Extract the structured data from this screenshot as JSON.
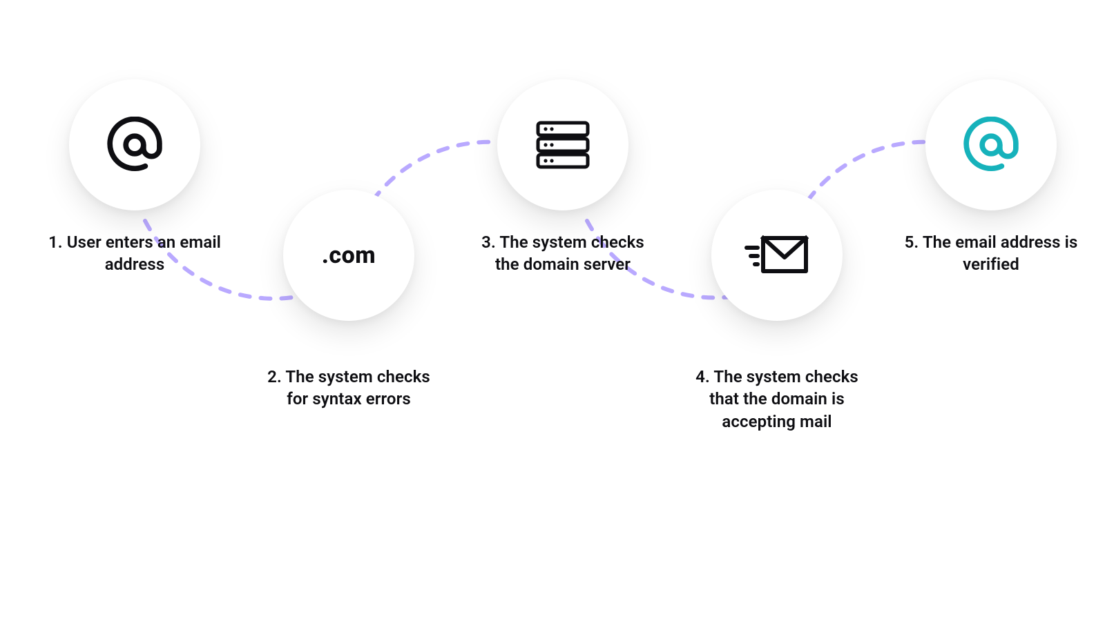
{
  "colors": {
    "text": "#0e0e12",
    "dash": "#b9a9ff",
    "teal": "#16b2bb",
    "black": "#0e0e12"
  },
  "steps": [
    {
      "id": "step1",
      "icon": "at-black",
      "caption": "1. User enters an email address"
    },
    {
      "id": "step2",
      "icon": "dot-com",
      "caption": "2. The system checks for syntax errors",
      "icon_text": ".com"
    },
    {
      "id": "step3",
      "icon": "server",
      "caption": "3. The system checks the domain server"
    },
    {
      "id": "step4",
      "icon": "mail-send",
      "caption": "4. The system checks that the domain is accepting mail"
    },
    {
      "id": "step5",
      "icon": "at-teal",
      "caption": "5. The email address is verified"
    }
  ]
}
